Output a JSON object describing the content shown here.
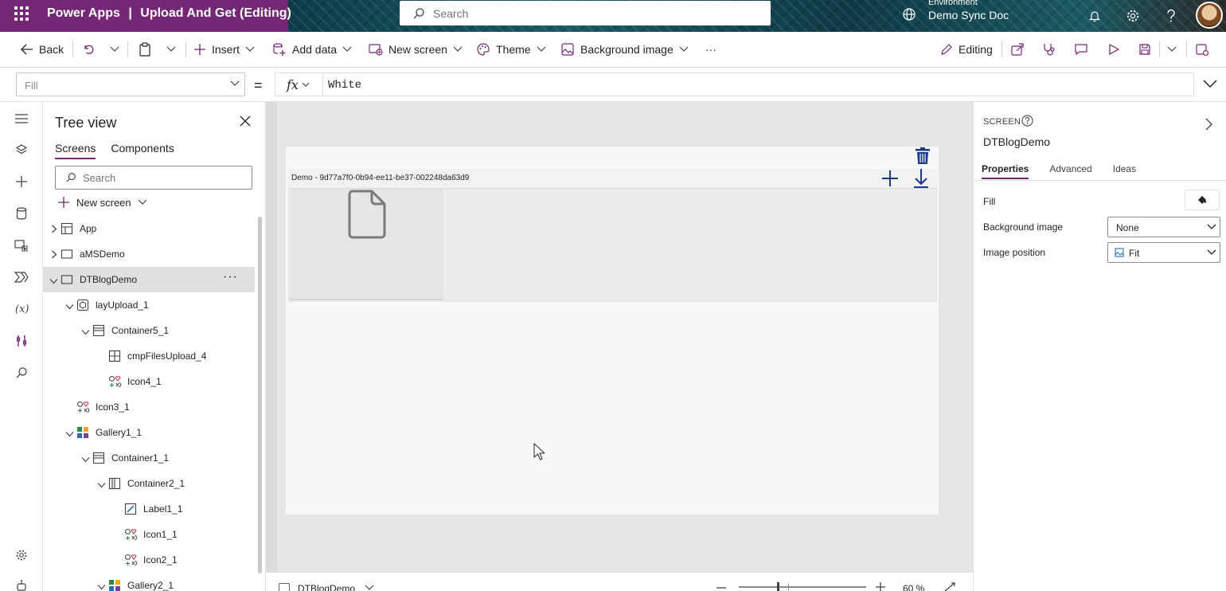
{
  "header": {
    "app_name": "Power Apps",
    "separator": "|",
    "doc_title": "Upload And Get (Editing)",
    "search_placeholder": "Search",
    "environment_label": "Environment",
    "environment_name": "Demo Sync Doc"
  },
  "commands": {
    "back": "Back",
    "insert": "Insert",
    "add_data": "Add data",
    "new_screen": "New screen",
    "theme": "Theme",
    "background_image": "Background image",
    "more": "···",
    "editing": "Editing"
  },
  "formula_bar": {
    "property": "Fill",
    "equals": "=",
    "fx": "fx",
    "formula": "White"
  },
  "tree_view": {
    "title": "Tree view",
    "tabs": [
      "Screens",
      "Components"
    ],
    "search_placeholder": "Search",
    "new_screen": "New screen",
    "more": "···",
    "items": [
      {
        "label": "App",
        "icon": "app-icon",
        "depth": 0,
        "chevron": "right"
      },
      {
        "label": "aMSDemo",
        "icon": "screen-icon",
        "depth": 0,
        "chevron": "right"
      },
      {
        "label": "DTBlogDemo",
        "icon": "screen-icon",
        "depth": 0,
        "chevron": "down",
        "selected": true
      },
      {
        "label": "layUpload_1",
        "icon": "component-icon",
        "depth": 1,
        "chevron": "down"
      },
      {
        "label": "Container5_1",
        "icon": "vertical-container-icon",
        "depth": 2,
        "chevron": "down"
      },
      {
        "label": "cmpFilesUpload_4",
        "icon": "component-instance-icon",
        "depth": 3,
        "chevron": "none"
      },
      {
        "label": "Icon4_1",
        "icon": "shapes-icon",
        "depth": 3,
        "chevron": "none"
      },
      {
        "label": "Icon3_1",
        "icon": "shapes-icon",
        "depth": 1,
        "chevron": "none"
      },
      {
        "label": "Gallery1_1",
        "icon": "gallery-icon",
        "depth": 1,
        "chevron": "down"
      },
      {
        "label": "Container1_1",
        "icon": "vertical-container-icon",
        "depth": 2,
        "chevron": "down"
      },
      {
        "label": "Container2_1",
        "icon": "horizontal-container-icon",
        "depth": 3,
        "chevron": "down"
      },
      {
        "label": "Label1_1",
        "icon": "label-icon",
        "depth": 4,
        "chevron": "none"
      },
      {
        "label": "Icon1_1",
        "icon": "shapes-icon",
        "depth": 4,
        "chevron": "none"
      },
      {
        "label": "Icon2_1",
        "icon": "shapes-icon",
        "depth": 4,
        "chevron": "none"
      },
      {
        "label": "Gallery2_1",
        "icon": "gallery-icon",
        "depth": 3,
        "chevron": "down"
      }
    ]
  },
  "canvas": {
    "gallery_header": "Demo - 9d77a7f0-0b94-ee11-be37-002248da63d9"
  },
  "status_bar": {
    "screen_name": "DTBlogDemo",
    "zoom": "60 %"
  },
  "properties": {
    "kind": "SCREEN",
    "control_name": "DTBlogDemo",
    "tabs": [
      "Properties",
      "Advanced",
      "Ideas"
    ],
    "fill_label": "Fill",
    "background_image_label": "Background image",
    "background_image_value": "None",
    "image_position_label": "Image position",
    "image_position_value": "Fit"
  },
  "colors": {
    "brand": "#742774",
    "canvas_bg": "#e6e6e6",
    "screen_bg": "#f8f8f8",
    "icon_blue": "#1b3a8a"
  }
}
